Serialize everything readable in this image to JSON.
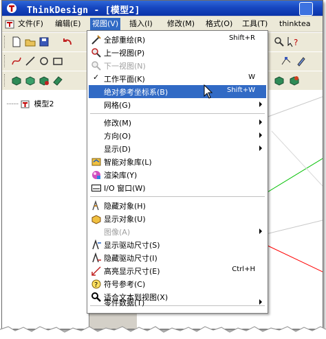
{
  "window": {
    "title": "ThinkDesign  - [模型2]"
  },
  "menubar": {
    "items": [
      {
        "label": "文件(F)"
      },
      {
        "label": "编辑(E)"
      },
      {
        "label": "视图(V)"
      },
      {
        "label": "插入(I)"
      },
      {
        "label": "修改(M)"
      },
      {
        "label": "格式(O)"
      },
      {
        "label": "工具(T)"
      },
      {
        "label": "thinktea"
      }
    ]
  },
  "tree": {
    "root_label": "模型2"
  },
  "view_menu": {
    "redraw_all": {
      "label": "全部重绘(R)",
      "shortcut": "Shift+R"
    },
    "prev_view": {
      "label": "上一视图(P)"
    },
    "next_view": {
      "label": "下一视图(N)"
    },
    "work_plane": {
      "label": "工作平面(K)",
      "shortcut": "W"
    },
    "abs_ref_frame": {
      "label": "绝对参考坐标系(B)",
      "shortcut": "Shift+W"
    },
    "grid": {
      "label": "网格(G)"
    },
    "modify": {
      "label": "修改(M)"
    },
    "direction": {
      "label": "方向(O)"
    },
    "display": {
      "label": "显示(D)"
    },
    "smart_object_lib": {
      "label": "智能对象库(L)"
    },
    "render_lib": {
      "label": "渲染库(Y)"
    },
    "io_window": {
      "label": "I/O 窗口(W)"
    },
    "hide_objects": {
      "label": "隐藏对象(H)"
    },
    "show_objects": {
      "label": "显示对象(U)"
    },
    "image": {
      "label": "图像(A)"
    },
    "show_driving_dims": {
      "label": "显示驱动尺寸(S)"
    },
    "hide_driving_dims": {
      "label": "隐藏驱动尺寸(I)"
    },
    "highlight_dims": {
      "label": "高亮显示尺寸(E)",
      "shortcut": "Ctrl+H"
    },
    "symbol_reference": {
      "label": "符号参考(C)"
    },
    "fit_text_to_view": {
      "label": "适合文本到视图(X)"
    },
    "part_data": {
      "label": "零件数据(T)"
    }
  },
  "colors": {
    "titlebar": "#0b33a8",
    "menu_highlight": "#316ac5",
    "viewport_axis_green": "#00c000",
    "viewport_axis_red": "#ff0000"
  }
}
